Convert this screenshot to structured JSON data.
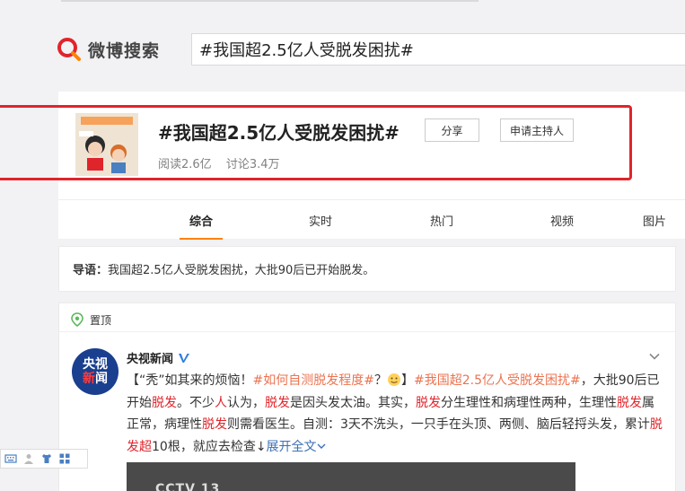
{
  "colors": {
    "accent": "#ff8200",
    "highlight": "#e0242b",
    "link": "#eb7350",
    "verified": "#2f7fe0"
  },
  "logo": {
    "text": "微博搜索"
  },
  "search": {
    "value": "#我国超2.5亿人受脱发困扰#"
  },
  "topic": {
    "title": "#我国超2.5亿人受脱发困扰#",
    "reads": "阅读2.6亿",
    "discussions": "讨论3.4万",
    "share_label": "分享",
    "host_label": "申请主持人",
    "thumb_caption": "大批90后已开始脱发"
  },
  "tabs": [
    {
      "label": "综合",
      "active": true
    },
    {
      "label": "实时"
    },
    {
      "label": "热门"
    },
    {
      "label": "视频"
    },
    {
      "label": "图片"
    }
  ],
  "guide": {
    "label": "导语：",
    "text": "我国超2.5亿人受脱发困扰，大批90后已开始脱发。"
  },
  "feed": {
    "pin_label": "置顶",
    "author": "央视新闻",
    "avatar_top": "央视",
    "avatar_bottom_1": "新",
    "avatar_bottom_2": "闻",
    "post": {
      "p1": "【“秃”如其来的烦恼！",
      "tag1": "#如何自测脱发程度#",
      "p2": "？",
      "p3": "】",
      "tag2": "#我国超2.5亿人受脱发困扰#",
      "p4": "，大批90后已开始",
      "kw1": "脱发",
      "p5": "。不少",
      "kw2": "人",
      "p6": "认为，",
      "kw3": "脱发",
      "p7": "是因头发太油。其实，",
      "kw4": "脱发",
      "p8": "分生理性和病理性两种，生理性",
      "kw5": "脱发",
      "p9": "属正常，病理性",
      "kw6": "脱发",
      "p10": "则需看医生。自测：3天不洗头，一只手在头顶、两侧、脑后轻捋头发，累计",
      "kw7": "脱发超",
      "p11": "10根，就应去检查↓",
      "expand": "展开全文"
    },
    "video_logo": "CCTV 13"
  }
}
